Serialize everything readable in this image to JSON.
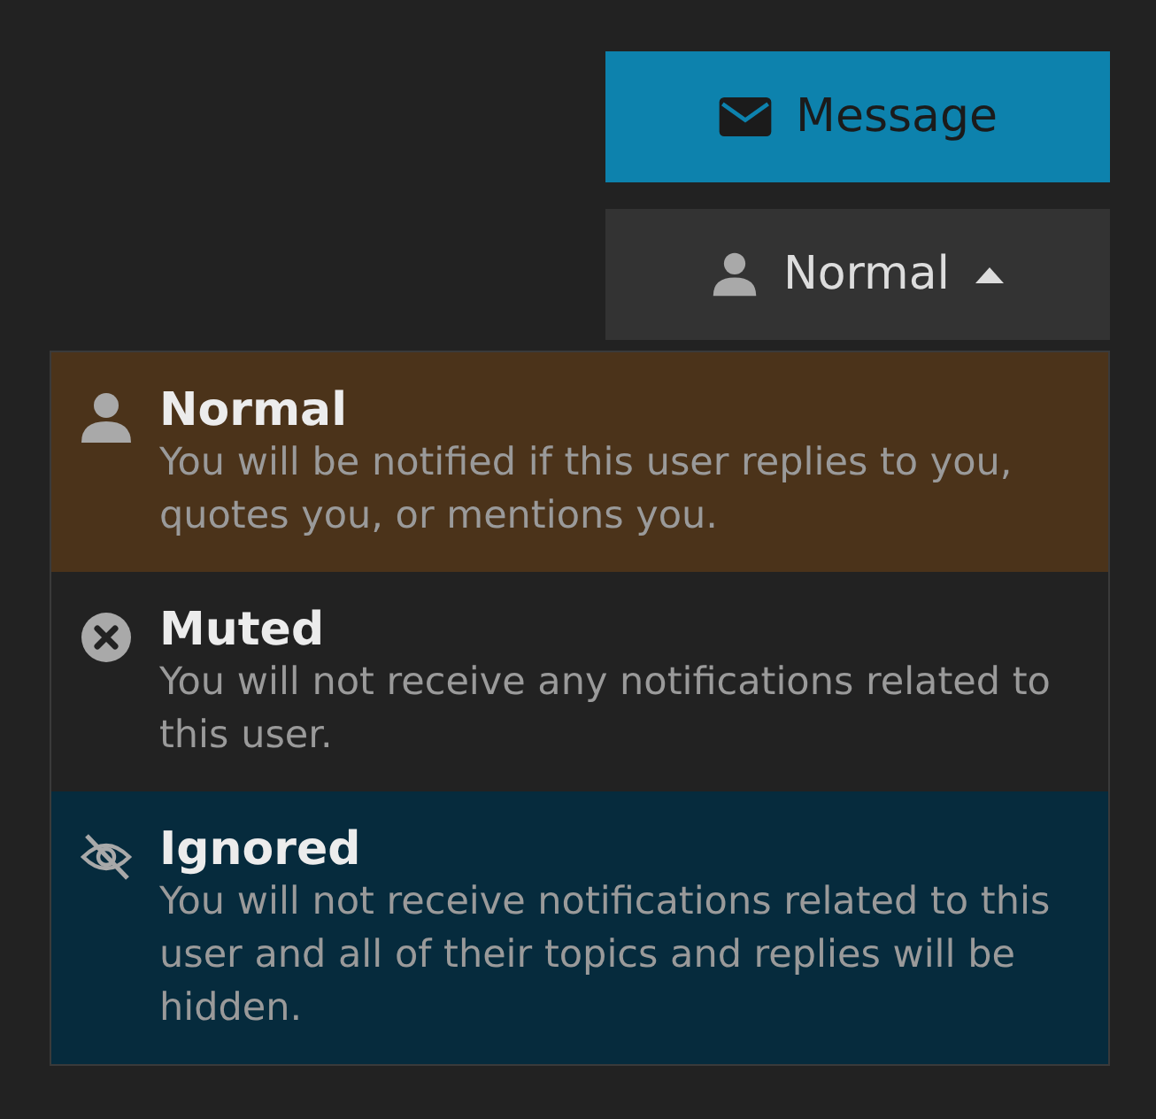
{
  "message_button": {
    "label": "Message"
  },
  "notification_button": {
    "label": "Normal",
    "expanded": true
  },
  "menu_items": [
    {
      "kind": "normal",
      "title": "Normal",
      "description": "You will be notified if this user replies to you, quotes you, or mentions you.",
      "selected": true,
      "hovered": false
    },
    {
      "kind": "muted",
      "title": "Muted",
      "description": "You will not receive any notifications related to this user.",
      "selected": false,
      "hovered": false
    },
    {
      "kind": "ignored",
      "title": "Ignored",
      "description": "You will not receive notifications related to this user and all of their topics and replies will be hidden.",
      "selected": false,
      "hovered": true
    }
  ]
}
